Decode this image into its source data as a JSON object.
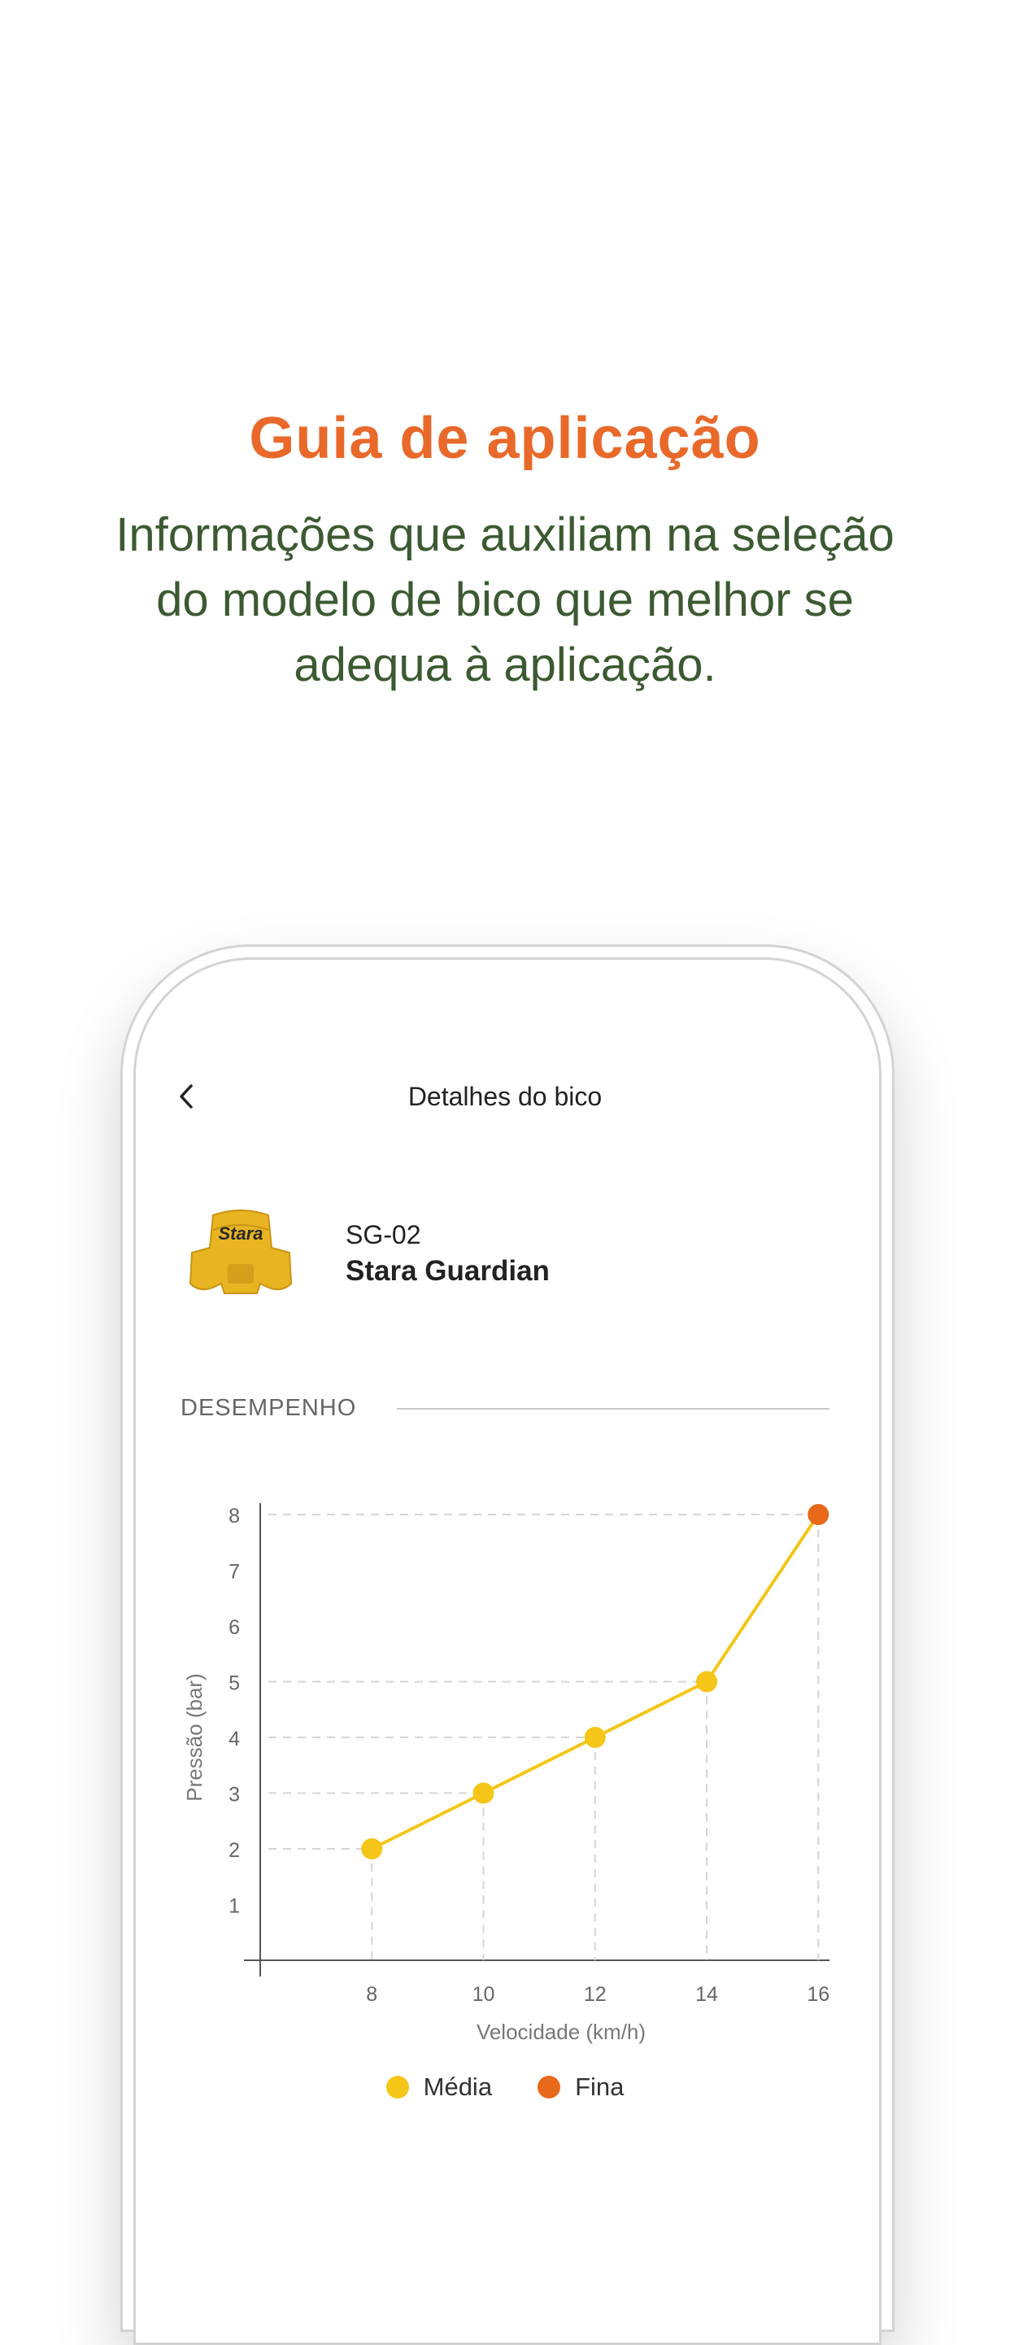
{
  "hero": {
    "title": "Guia de aplicação",
    "subtitle": "Informações que auxiliam na seleção do modelo de bico que melhor se adequa à aplicação."
  },
  "screen": {
    "back_icon": "chevron-left-icon",
    "title": "Detalhes do bico"
  },
  "nozzle": {
    "brand_logo": "Stara",
    "code": "SG-02",
    "name": "Stara Guardian",
    "color": "#e8b421"
  },
  "section": {
    "label": "DESEMPENHO"
  },
  "colors": {
    "accent_orange": "#e8692a",
    "text_green": "#3c5a31",
    "series_yellow": "#f5c518",
    "series_orange": "#e8691a"
  },
  "chart_data": {
    "type": "line",
    "xlabel": "Velocidade (km/h)",
    "ylabel": "Pressão (bar)",
    "x_ticks": [
      "8",
      "10",
      "12",
      "14",
      "16"
    ],
    "y_ticks": [
      "1",
      "2",
      "3",
      "4",
      "5",
      "6",
      "7",
      "8"
    ],
    "x": [
      8,
      10,
      12,
      14,
      16
    ],
    "y": [
      2,
      3,
      4,
      5,
      8
    ],
    "xlim": [
      6,
      16.2
    ],
    "ylim": [
      0,
      8
    ],
    "point_categories": [
      "Média",
      "Média",
      "Média",
      "Média",
      "Fina"
    ],
    "grid": "dashed guides from points to axes",
    "legend": [
      {
        "label": "Média",
        "color": "#f5c518"
      },
      {
        "label": "Fina",
        "color": "#e8691a"
      }
    ],
    "legend_position": "bottom-center"
  }
}
